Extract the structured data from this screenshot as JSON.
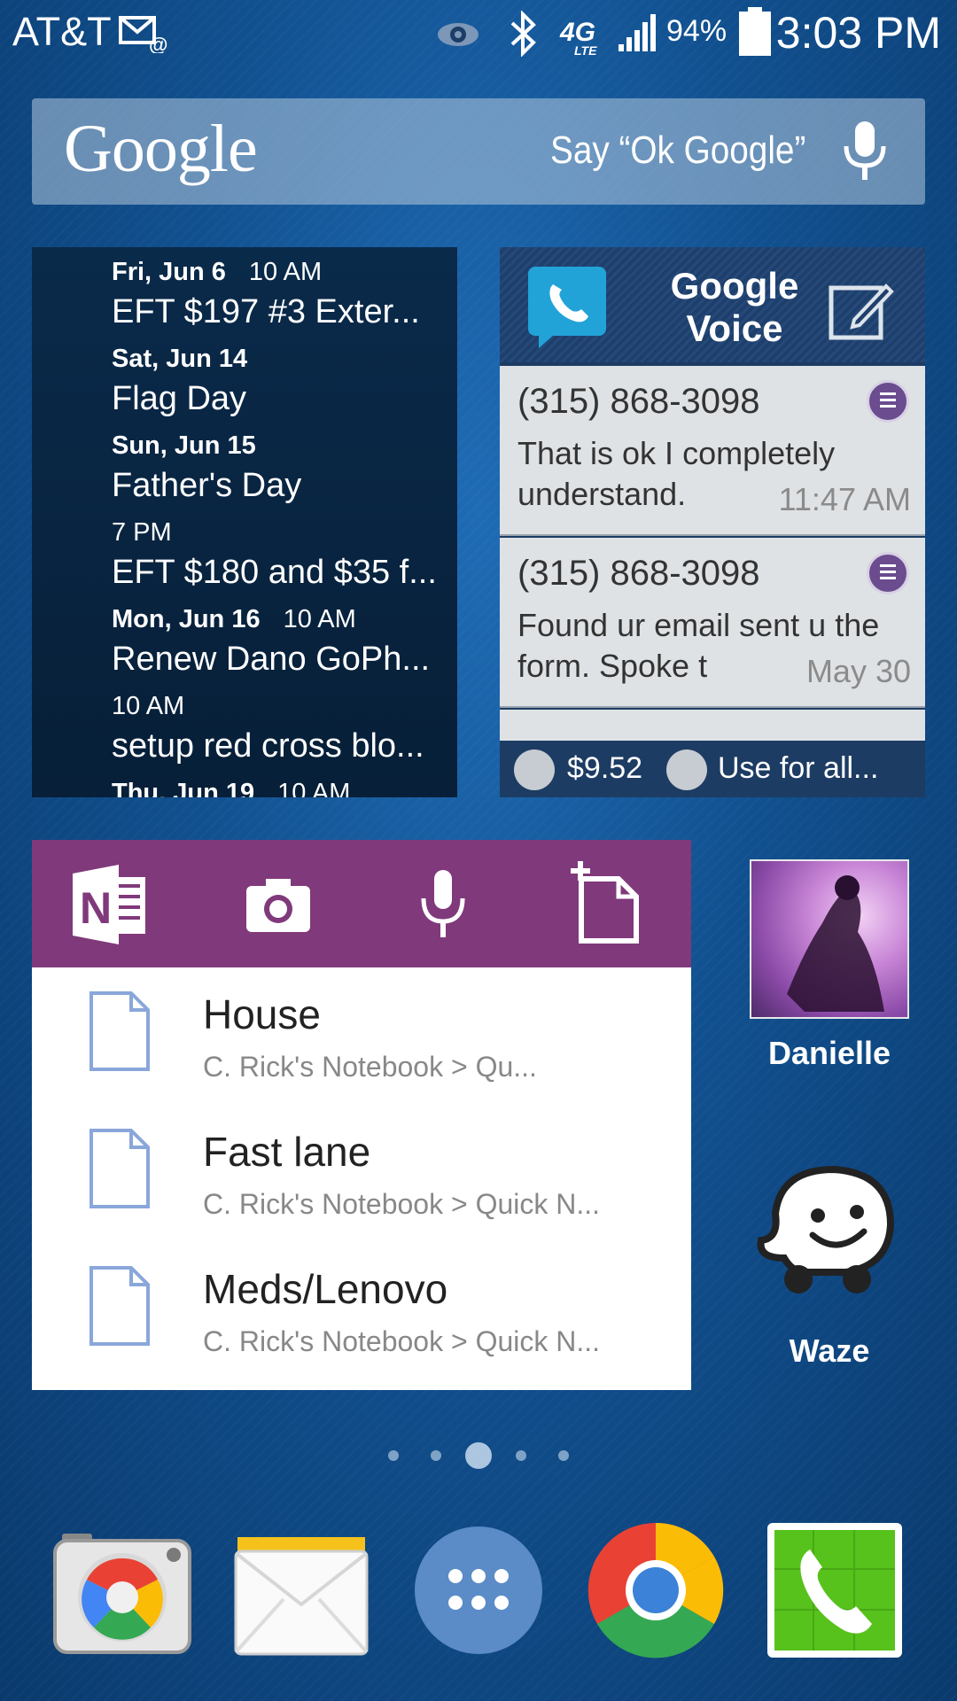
{
  "status_bar": {
    "carrier": "AT&T",
    "battery_percent": "94%",
    "time": "3:03 PM",
    "icons": [
      "email-notification-icon",
      "eye-icon",
      "bluetooth-icon",
      "4g-lte-icon",
      "signal-icon",
      "battery-icon"
    ]
  },
  "google_search": {
    "logo": "Google",
    "hint": "Say “Ok Google”"
  },
  "calendar": {
    "entries": [
      {
        "date": "Fri, Jun 6",
        "time": "10 AM",
        "title": "EFT $197 #3 Exter..."
      },
      {
        "date": "Sat, Jun 14",
        "time": "",
        "title": "Flag Day"
      },
      {
        "date": "Sun, Jun 15",
        "time": "",
        "title": "Father's Day"
      },
      {
        "date": "",
        "time": "7 PM",
        "title": "EFT $180 and $35 f..."
      },
      {
        "date": "Mon, Jun 16",
        "time": "10 AM",
        "title": "Renew Dano GoPh..."
      },
      {
        "date": "",
        "time": "10 AM",
        "title": "setup red cross blo..."
      },
      {
        "date": "Thu, Jun 19",
        "time": "10 AM",
        "title": ""
      }
    ]
  },
  "google_voice": {
    "title_line1": "Google",
    "title_line2": "Voice",
    "messages": [
      {
        "number": "(315) 868-3098",
        "text": "That is ok I completely understand.",
        "when": "11:47 AM"
      },
      {
        "number": "(315) 868-3098",
        "text": "Found ur email sent u the form. Spoke t",
        "when": "May 30"
      }
    ],
    "credit": "$9.52",
    "call_setting": "Use for all..."
  },
  "onenote": {
    "notes": [
      {
        "title": "House",
        "path": "C. Rick's Notebook > Qu..."
      },
      {
        "title": "Fast lane",
        "path": "C. Rick's Notebook > Quick N..."
      },
      {
        "title": "Meds/Lenovo",
        "path": "C. Rick's Notebook > Quick N..."
      }
    ]
  },
  "shortcuts": {
    "contact_name": "Danielle",
    "waze_label": "Waze"
  },
  "page_indicator": {
    "count": 5,
    "active": 3
  },
  "dock": [
    "camera-icon",
    "email-app-icon",
    "app-drawer-icon",
    "chrome-icon",
    "phone-icon"
  ],
  "colors": {
    "wallpaper": "#11508f",
    "onenote_purple": "#80397b",
    "gv_header": "#24497a",
    "calendar_bg": "#0a2a4a"
  }
}
